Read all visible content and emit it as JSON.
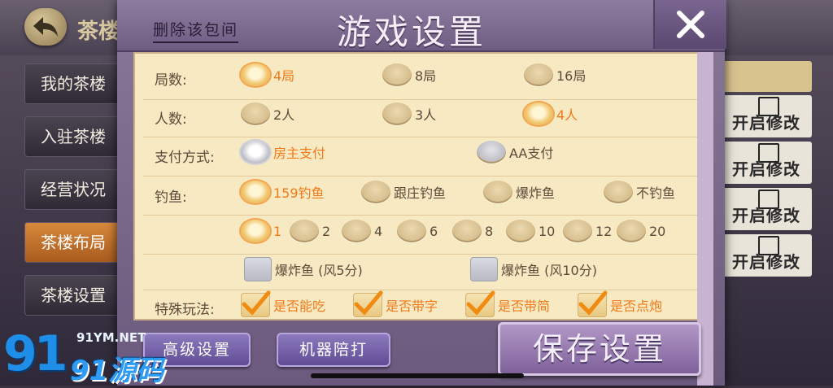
{
  "background": {
    "top_title": "茶楼",
    "left_menu": [
      "我的茶楼",
      "入驻茶楼",
      "经营状况",
      "茶楼布局",
      "茶楼设置"
    ],
    "active_menu_index": 3,
    "right_panel_rows": [
      "开启修改",
      "开启修改",
      "开启修改",
      "开启修改"
    ]
  },
  "dialog": {
    "title": "游戏设置",
    "delete_link": "删除该包间",
    "close_icon": "close-icon",
    "rows": {
      "rounds": {
        "label": "局数:",
        "options": [
          "4局",
          "8局",
          "16局"
        ],
        "selected": 0
      },
      "players": {
        "label": "人数:",
        "options": [
          "2人",
          "3人",
          "4人"
        ],
        "selected": 2
      },
      "payment": {
        "label": "支付方式:",
        "options": [
          "房主支付",
          "AA支付"
        ],
        "selected": 0
      },
      "fishing": {
        "label": "钓鱼:",
        "options": [
          "159钓鱼",
          "跟庄钓鱼",
          "爆炸鱼",
          "不钓鱼"
        ],
        "selected": 0
      },
      "fish_count": {
        "options": [
          "1",
          "2",
          "4",
          "6",
          "8",
          "10",
          "12",
          "20"
        ],
        "selected": 0
      },
      "bomb_fish": {
        "options": [
          "爆炸鱼 (风5分)",
          "爆炸鱼 (风10分)"
        ],
        "checked": [
          false,
          false
        ]
      },
      "special": {
        "label": "特殊玩法:",
        "options": [
          "是否能吃",
          "是否带字",
          "是否带简",
          "是否点炮"
        ],
        "checked": [
          true,
          true,
          true,
          true
        ]
      }
    },
    "buttons": {
      "advanced": "高级设置",
      "robot": "机器陪打",
      "save": "保存设置"
    }
  },
  "watermark": {
    "number": "91",
    "url": "91YM.NET",
    "brand": "91源码"
  },
  "colors": {
    "selected_text": "#f07a1a",
    "panel_bg": "#f7e9c2",
    "header_purple": "#7e6c94"
  }
}
